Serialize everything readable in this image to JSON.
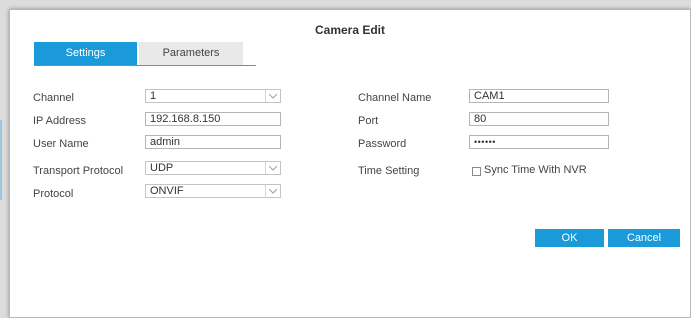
{
  "dialog": {
    "title": "Camera Edit"
  },
  "tabs": [
    {
      "label": "Settings",
      "active": true
    },
    {
      "label": "Parameters",
      "active": false
    }
  ],
  "left_fields": [
    {
      "label": "Channel",
      "value": "1",
      "type": "select"
    },
    {
      "label": "IP Address",
      "value": "192.168.8.150",
      "type": "text"
    },
    {
      "label": "User Name",
      "value": "admin",
      "type": "text"
    },
    {
      "label": "Transport Protocol",
      "value": "UDP",
      "type": "select"
    },
    {
      "label": "Protocol",
      "value": "ONVIF",
      "type": "select"
    }
  ],
  "right_fields": [
    {
      "label": "Channel Name",
      "value": "CAM1",
      "type": "text"
    },
    {
      "label": "Port",
      "value": "80",
      "type": "text"
    },
    {
      "label": "Password",
      "value": "••••••",
      "type": "password"
    },
    {
      "label": "Time Setting",
      "checkbox_label": "Sync Time With NVR",
      "checked": false
    }
  ],
  "buttons": {
    "ok": "OK",
    "cancel": "Cancel"
  },
  "colors": {
    "accent": "#1b9ad9",
    "tab_inactive": "#e9e9e9"
  }
}
